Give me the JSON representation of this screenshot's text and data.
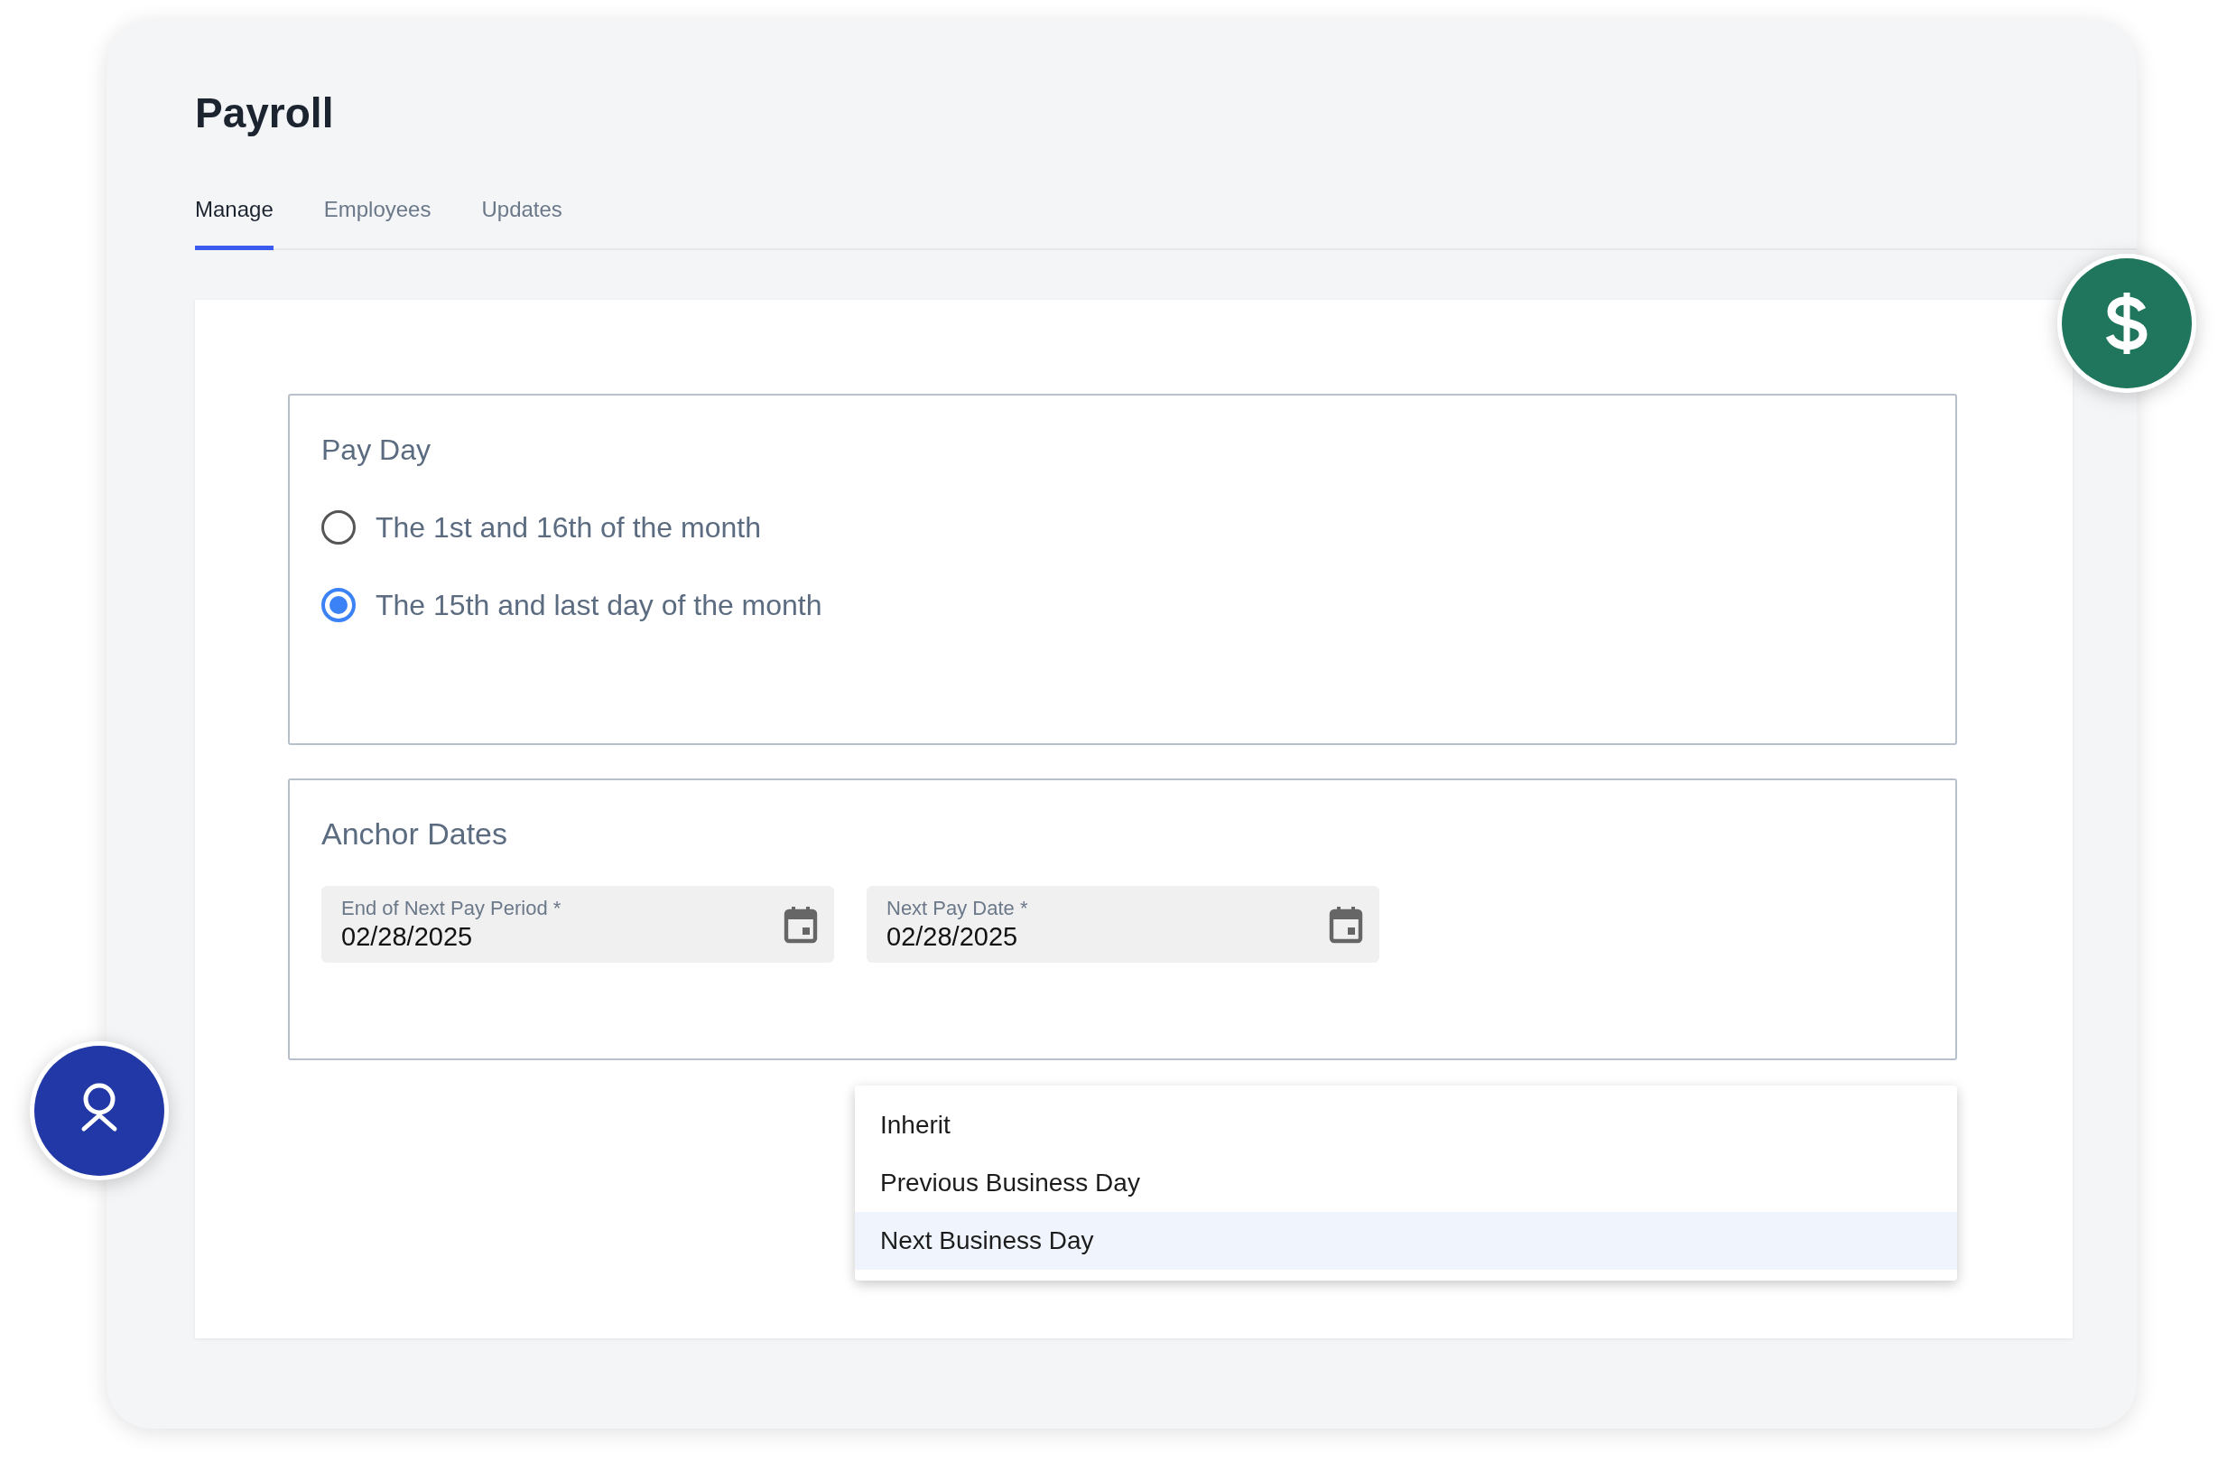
{
  "page": {
    "title": "Payroll"
  },
  "tabs": [
    {
      "label": "Manage",
      "selected": true
    },
    {
      "label": "Employees",
      "selected": false
    },
    {
      "label": "Updates",
      "selected": false
    }
  ],
  "pay_day": {
    "title": "Pay Day",
    "options": [
      {
        "label": "The 1st and 16th of the month",
        "selected": false
      },
      {
        "label": "The 15th and last day of the month",
        "selected": true
      }
    ]
  },
  "anchor_dates": {
    "title": "Anchor Dates",
    "fields": [
      {
        "label": "End of Next Pay Period *",
        "value": "02/28/2025"
      },
      {
        "label": "Next Pay Date *",
        "value": "02/28/2025"
      }
    ]
  },
  "dropdown_menu": {
    "items": [
      {
        "label": "Inherit",
        "selected": false
      },
      {
        "label": "Previous Business Day",
        "selected": false
      },
      {
        "label": "Next Business Day",
        "selected": true
      }
    ]
  }
}
